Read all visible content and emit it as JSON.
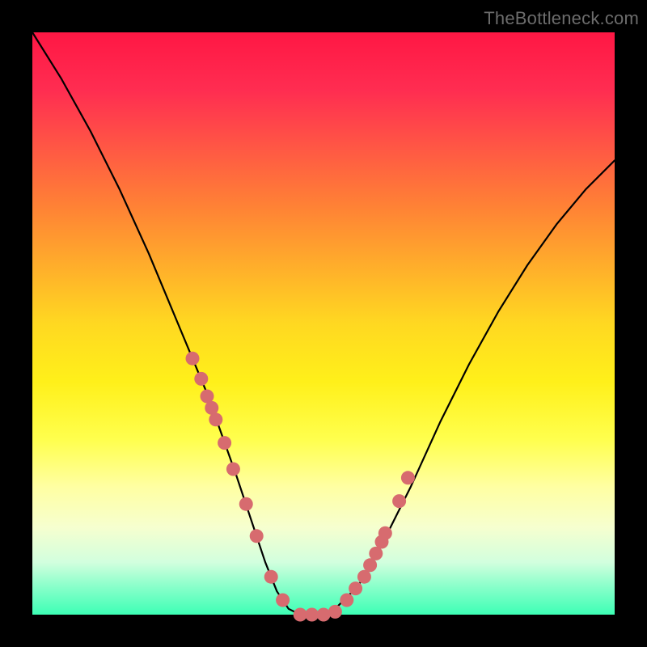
{
  "watermark": "TheBottleneck.com",
  "colors": {
    "background": "#000000",
    "curve": "#000000",
    "dot_fill": "#d76b6f",
    "dot_stroke": "#c45a5e",
    "gradient_top": "#ff1744",
    "gradient_bottom": "#3dffb5"
  },
  "chart_data": {
    "type": "line",
    "title": "",
    "xlabel": "",
    "ylabel": "",
    "ylim": [
      0,
      100
    ],
    "xlim": [
      0,
      100
    ],
    "series": [
      {
        "name": "bottleneck-curve",
        "x": [
          0,
          5,
          10,
          15,
          20,
          25,
          30,
          35,
          38,
          40,
          42,
          44,
          46,
          48,
          50,
          52,
          56,
          60,
          65,
          70,
          75,
          80,
          85,
          90,
          95,
          100
        ],
        "y": [
          100,
          92,
          83,
          73,
          62,
          50,
          38,
          24,
          15,
          9,
          4,
          1,
          0,
          0,
          0,
          1,
          5,
          12,
          22,
          33,
          43,
          52,
          60,
          67,
          73,
          78
        ]
      }
    ],
    "dots": {
      "name": "marker-dots",
      "x": [
        27.5,
        29,
        30,
        30.8,
        31.5,
        33,
        34.5,
        36.7,
        38.5,
        41,
        43,
        46,
        48,
        50,
        52,
        54,
        55.5,
        57,
        58,
        59,
        60,
        60.6,
        63,
        64.5
      ],
      "y": [
        44,
        40.5,
        37.5,
        35.5,
        33.5,
        29.5,
        25,
        19,
        13.5,
        6.5,
        2.5,
        0,
        0,
        0,
        0.5,
        2.5,
        4.5,
        6.5,
        8.5,
        10.5,
        12.5,
        14,
        19.5,
        23.5
      ]
    }
  }
}
